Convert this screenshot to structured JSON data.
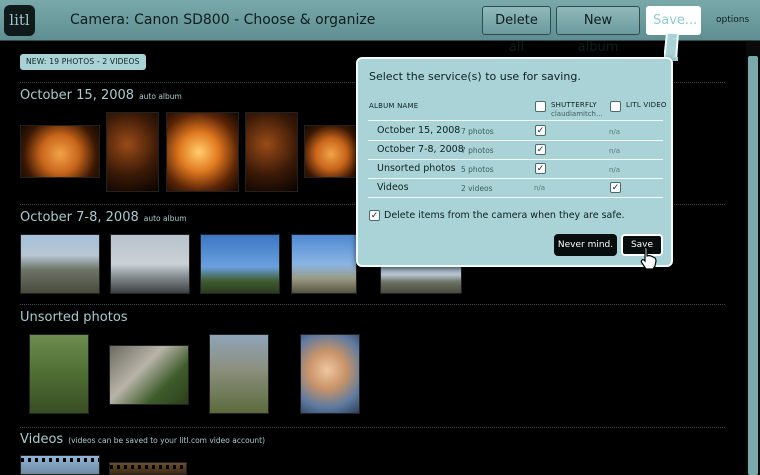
{
  "header": {
    "logo_text": "litl",
    "title": "Camera: Canon SD800 - Choose & organize",
    "delete_all": "Delete all",
    "new_album": "New album",
    "save": "Save...",
    "options": "options"
  },
  "badge": "NEW: 19 PHOTOS - 2 VIDEOS",
  "sections": [
    {
      "title": "October 15, 2008",
      "sub": "auto album"
    },
    {
      "title": "October 7-8, 2008",
      "sub": "auto album"
    },
    {
      "title": "Unsorted photos",
      "sub": ""
    },
    {
      "title": "Videos",
      "sub": "(videos can be saved to your litl.com video account)"
    }
  ],
  "popover": {
    "title": "Select the service(s) to use for saving.",
    "col_album": "ALBUM NAME",
    "col_shutterfly": "SHUTTERFLY",
    "col_shutterfly_sub": "claudiamitch...",
    "col_litl": "LITL VIDEO",
    "rows": [
      {
        "name": "October 15, 2008",
        "count": "7 photos",
        "shutterfly": true,
        "litl": "n/a"
      },
      {
        "name": "October 7-8, 2008",
        "count": "7 photos",
        "shutterfly": true,
        "litl": "n/a"
      },
      {
        "name": "Unsorted photos",
        "count": "5 photos",
        "shutterfly": true,
        "litl": "n/a"
      },
      {
        "name": "Videos",
        "count": "2 videos",
        "shutterfly": "n/a",
        "litl": true
      }
    ],
    "delete_label": "Delete items from the camera when they are safe.",
    "never_mind": "Never mind.",
    "save": "Save"
  },
  "colors": {
    "accent": "#7aa9ab",
    "popover_bg": "#a9d3d6",
    "button_dark": "#070d0d"
  }
}
